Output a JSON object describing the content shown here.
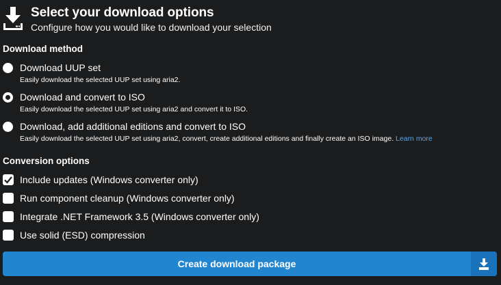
{
  "header": {
    "icon": "download-icon",
    "title": "Select your download options",
    "subtitle": "Configure how you would like to download your selection"
  },
  "download_method": {
    "label": "Download method",
    "options": [
      {
        "label": "Download UUP set",
        "description": "Easily download the selected UUP set using aria2.",
        "selected": false
      },
      {
        "label": "Download and convert to ISO",
        "description": "Easily download the selected UUP set using aria2 and convert it to ISO.",
        "selected": true
      },
      {
        "label": "Download, add additional editions and convert to ISO",
        "description": "Easily download the selected UUP set using aria2, convert, create additional editions and finally create an ISO image.",
        "link": "Learn more",
        "selected": false
      }
    ]
  },
  "conversion_options": {
    "label": "Conversion options",
    "options": [
      {
        "label": "Include updates (Windows converter only)",
        "checked": true
      },
      {
        "label": "Run component cleanup (Windows converter only)",
        "checked": false
      },
      {
        "label": "Integrate .NET Framework 3.5 (Windows converter only)",
        "checked": false
      },
      {
        "label": "Use solid (ESD) compression",
        "checked": false
      }
    ]
  },
  "action": {
    "label": "Create download package",
    "icon": "download-icon"
  },
  "colors": {
    "background": "#1b1c1d",
    "primary": "#2185d0",
    "link": "#5aa6e8"
  }
}
